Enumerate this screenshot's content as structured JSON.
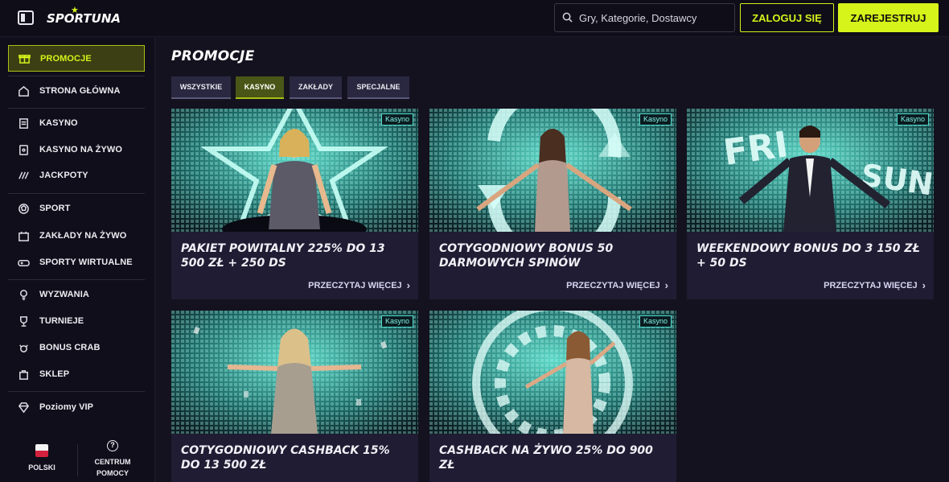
{
  "header": {
    "logo_text": "SPORTUNA",
    "search_placeholder": "Gry, Kategorie, Dostawcy",
    "login_label": "ZALOGUJ SIĘ",
    "register_label": "ZAREJESTRUJ"
  },
  "sidebar": {
    "items": [
      {
        "label": "PROMOCJE",
        "icon": "gift-icon"
      },
      {
        "label": "STRONA GŁÓWNA",
        "icon": "home-icon"
      },
      {
        "label": "KASYNO",
        "icon": "casino-icon"
      },
      {
        "label": "KASYNO NA ŻYWO",
        "icon": "live-casino-icon"
      },
      {
        "label": "JACKPOTY",
        "icon": "jackpot-icon"
      },
      {
        "label": "SPORT",
        "icon": "ball-icon"
      },
      {
        "label": "ZAKŁADY NA ŻYWO",
        "icon": "live-bet-icon"
      },
      {
        "label": "SPORTY WIRTUALNE",
        "icon": "gamepad-icon"
      },
      {
        "label": "WYZWANIA",
        "icon": "lightbulb-icon"
      },
      {
        "label": "TURNIEJE",
        "icon": "trophy-icon"
      },
      {
        "label": "BONUS CRAB",
        "icon": "crab-icon"
      },
      {
        "label": "SKLEP",
        "icon": "shop-icon"
      },
      {
        "label": "Poziomy VIP",
        "icon": "diamond-icon"
      }
    ],
    "language_label": "POLSKI",
    "help_label_line1": "CENTRUM",
    "help_label_line2": "POMOCY"
  },
  "main": {
    "title": "PROMOCJE",
    "tabs": [
      "WSZYSTKIE",
      "KASYNO",
      "ZAKŁADY",
      "SPECJALNE"
    ],
    "active_tab": "KASYNO",
    "read_more_label": "PRZECZYTAJ WIĘCEJ",
    "cards": [
      {
        "badge": "Kasyno",
        "title": "PAKIET POWITALNY 225% DO 13 500 ZŁ + 250 DS"
      },
      {
        "badge": "Kasyno",
        "title": "COTYGODNIOWY BONUS 50 DARMOWYCH SPINÓW"
      },
      {
        "badge": "Kasyno",
        "title": "WEEKENDOWY BONUS DO 3 150 ZŁ + 50 DS",
        "image_text_left": "FRI",
        "image_text_right": "SUN"
      },
      {
        "badge": "Kasyno",
        "title": "COTYGODNIOWY CASHBACK 15% DO 13 500 ZŁ"
      },
      {
        "badge": "Kasyno",
        "title": "CASHBACK NA ŻYWO 25% DO 900 ZŁ"
      }
    ]
  },
  "colors": {
    "accent": "#d6f31a",
    "background": "#14121f",
    "card": "#1f1c33",
    "teal": "#4fd7c9"
  }
}
